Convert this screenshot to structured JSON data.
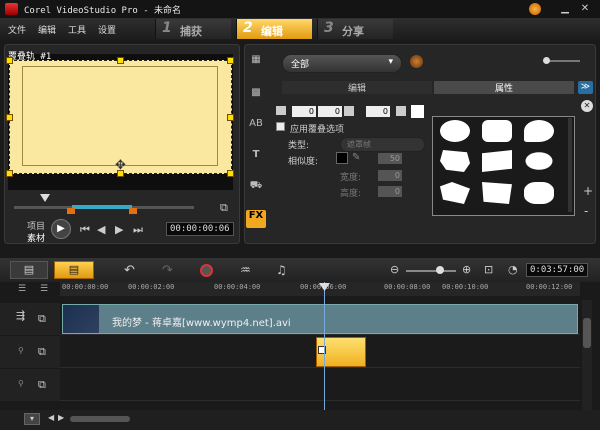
{
  "window": {
    "title": "Corel VideoStudio Pro - 未命名",
    "controls": [
      "minimize-icon",
      "close-icon"
    ]
  },
  "menu": {
    "items": [
      "文件",
      "编辑",
      "工具",
      "设置"
    ]
  },
  "steps": [
    {
      "num": "1",
      "label": "捕获",
      "active": false
    },
    {
      "num": "2",
      "label": "编辑",
      "active": true
    },
    {
      "num": "3",
      "label": "分享",
      "active": false
    }
  ],
  "preview": {
    "clip_name": "覆叠轨 #1",
    "mode_project": "项目",
    "mode_clip": "素材",
    "timecode": "00:00:00:06"
  },
  "library": {
    "filter": "全部",
    "subtabs": [
      "编辑",
      "属性"
    ],
    "active_subtab": "属性",
    "spin1": "0",
    "spin2": "0",
    "spin3": "0",
    "apply_overlay_label": "应用覆叠选项",
    "type_label": "类型:",
    "type_value": "遮罩帧",
    "similarity_label": "相似度:",
    "similarity_value": "50",
    "width_label": "宽度:",
    "width_value": "0",
    "height_label": "高度:",
    "height_value": "0"
  },
  "timeline": {
    "timecode": "0:03:57:00",
    "ruler": [
      "00:00:00:00",
      "00:00:02:00",
      "00:00:04:00",
      "00:00:06:00",
      "00:00:08:00",
      "00:00:10:00",
      "00:00:12:00"
    ],
    "video_clip_label": "我的梦 - 蒋卓嘉[www.wymp4.net].avi"
  },
  "colors": {
    "accent": "#f0a820",
    "overlay_fill": "#fbe8a0",
    "video_clip": "#5d7f8a",
    "playhead": "#7ad"
  }
}
